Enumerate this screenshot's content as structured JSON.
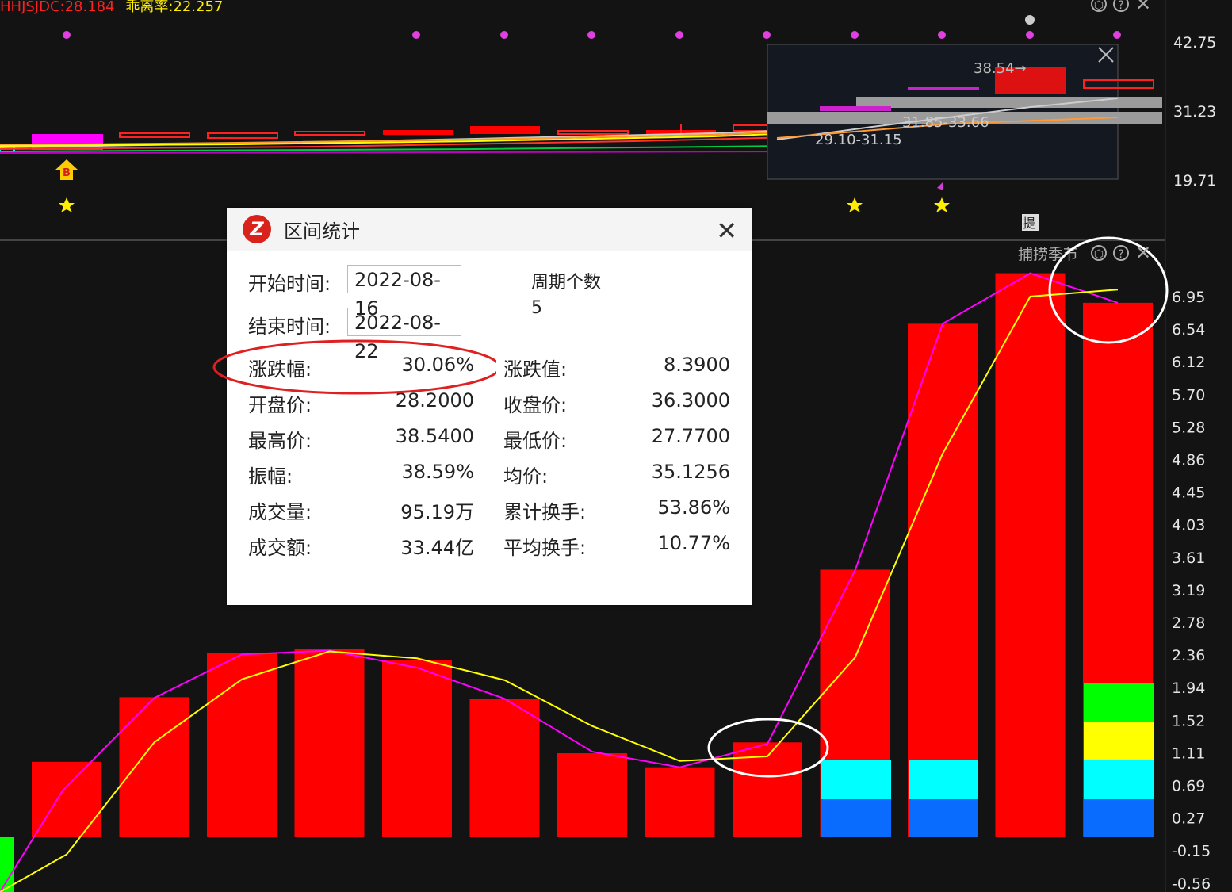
{
  "header": {
    "indicator_1": "HHJSJDC:28.184",
    "indicator_2": "乖离率:22.257"
  },
  "price_axis": [
    "42.75",
    "31.23",
    "19.71"
  ],
  "indicator_axis": [
    "6.95",
    "6.54",
    "6.12",
    "5.70",
    "5.28",
    "4.86",
    "4.45",
    "4.03",
    "3.61",
    "3.19",
    "2.78",
    "2.36",
    "1.94",
    "1.52",
    "1.11",
    "0.69",
    "0.27",
    "-0.15",
    "-0.56"
  ],
  "indicator_pane": {
    "title": "捕捞季节"
  },
  "zoom_inset": {
    "high_label": "38.54→",
    "range_label_1": "31.85-33.66",
    "range_label_2": "29.10-31.15"
  },
  "markers": {
    "buy_label": "B",
    "hint_label": "提"
  },
  "colors": {
    "up": "#ff0000",
    "magenta": "#ff00ff",
    "yellow": "#ffff00",
    "cyan": "#00ffff",
    "blue": "#0a6cff",
    "green": "#00ff00"
  },
  "chart_data": {
    "type": "bar",
    "categories": [
      "1",
      "2",
      "3",
      "4",
      "5",
      "6",
      "7",
      "8",
      "9",
      "10",
      "11",
      "12",
      "13"
    ],
    "series": [
      {
        "values": [
          0.97,
          1.8,
          2.37,
          2.42,
          2.28,
          1.78,
          1.08,
          0.9,
          1.22,
          3.44,
          6.6,
          7.25,
          6.87
        ]
      }
    ],
    "lines": {
      "magenta": [
        0.06,
        1.79,
        2.35,
        2.4,
        2.18,
        1.78,
        1.1,
        0.9,
        1.2,
        3.43,
        6.6,
        7.25,
        6.87
      ],
      "yellow": [
        -0.22,
        1.22,
        2.03,
        2.39,
        2.3,
        2.02,
        1.43,
        0.98,
        1.04,
        2.31,
        4.93,
        6.95,
        7.04
      ]
    },
    "ylim": [
      -0.66,
      7.46
    ]
  },
  "dialog": {
    "title": "区间统计",
    "start_label": "开始时间:",
    "start_value": "2022-08-16",
    "end_label": "结束时间:",
    "end_value": "2022-08-22",
    "period_label": "周期个数",
    "period_value": "5",
    "stats": [
      {
        "l1": "涨跌幅:",
        "v1": "30.06%",
        "l2": "涨跌值:",
        "v2": "8.3900"
      },
      {
        "l1": "开盘价:",
        "v1": "28.2000",
        "l2": "收盘价:",
        "v2": "36.3000"
      },
      {
        "l1": "最高价:",
        "v1": "38.5400",
        "l2": "最低价:",
        "v2": "27.7700"
      },
      {
        "l1": "振幅:",
        "v1": "38.59%",
        "l2": "均价:",
        "v2": "35.1256"
      },
      {
        "l1": "成交量:",
        "v1": "95.19万",
        "l2": "累计换手:",
        "v2": "53.86%"
      },
      {
        "l1": "成交额:",
        "v1": "33.44亿",
        "l2": "平均换手:",
        "v2": "10.77%"
      }
    ]
  }
}
